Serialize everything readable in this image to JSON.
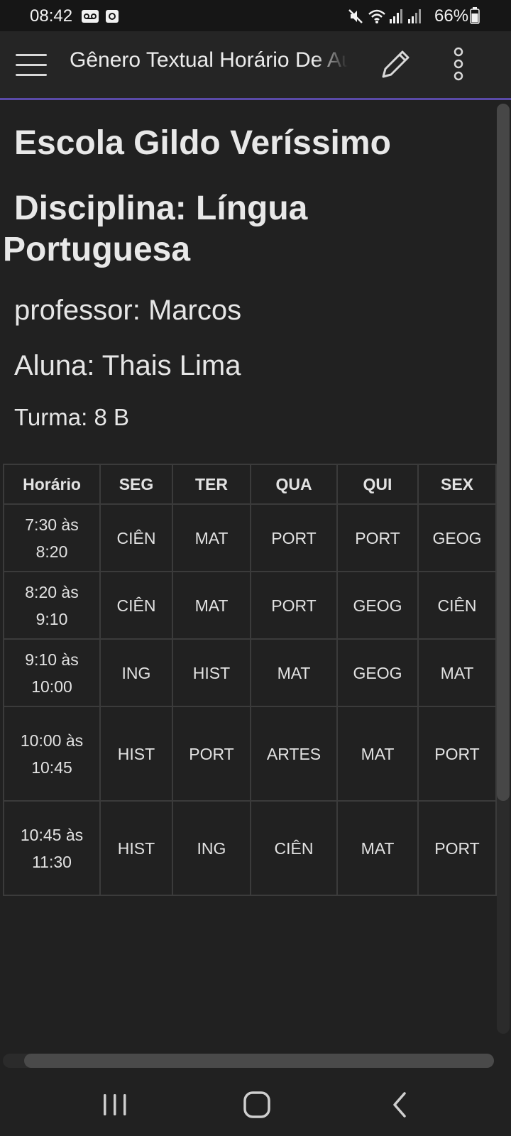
{
  "status_bar": {
    "time": "08:42",
    "battery": "66%",
    "icons": [
      "voicemail-icon",
      "screen-record-icon",
      "mute-icon",
      "wifi-icon",
      "signal-icon",
      "signal-icon",
      "battery-icon"
    ]
  },
  "app_bar": {
    "title": "Gênero Textual Horário De Aula",
    "icons": [
      "menu-icon",
      "edit-pencil-icon",
      "more-vert-icon"
    ]
  },
  "document": {
    "school": "Escola Gildo Veríssimo",
    "discipline": "Disciplina: Língua Portuguesa",
    "teacher": "professor: Marcos",
    "student": "Aluna: Thais Lima",
    "class": "Turma: 8 B"
  },
  "schedule": {
    "headers": [
      "Horário",
      "SEG",
      "TER",
      "QUA",
      "QUI",
      "SEX"
    ],
    "rows": [
      [
        "7:30 às 8:20",
        "CIÊN",
        "MAT",
        "PORT",
        "PORT",
        "GEOG"
      ],
      [
        "8:20 às 9:10",
        "CIÊN",
        "MAT",
        "PORT",
        "GEOG",
        "CIÊN"
      ],
      [
        "9:10 às 10:00",
        "ING",
        "HIST",
        "MAT",
        "GEOG",
        "MAT"
      ],
      [
        "10:00 às 10:45",
        "HIST",
        "PORT",
        "ARTES",
        "MAT",
        "PORT"
      ],
      [
        "10:45 às 11:30",
        "HIST",
        "ING",
        "CIÊN",
        "MAT",
        "PORT"
      ]
    ]
  },
  "nav_bar": {
    "icons": [
      "recent-apps-icon",
      "home-icon",
      "back-icon"
    ]
  },
  "colors": {
    "background": "#212121",
    "accent": "#5a4aa8"
  }
}
